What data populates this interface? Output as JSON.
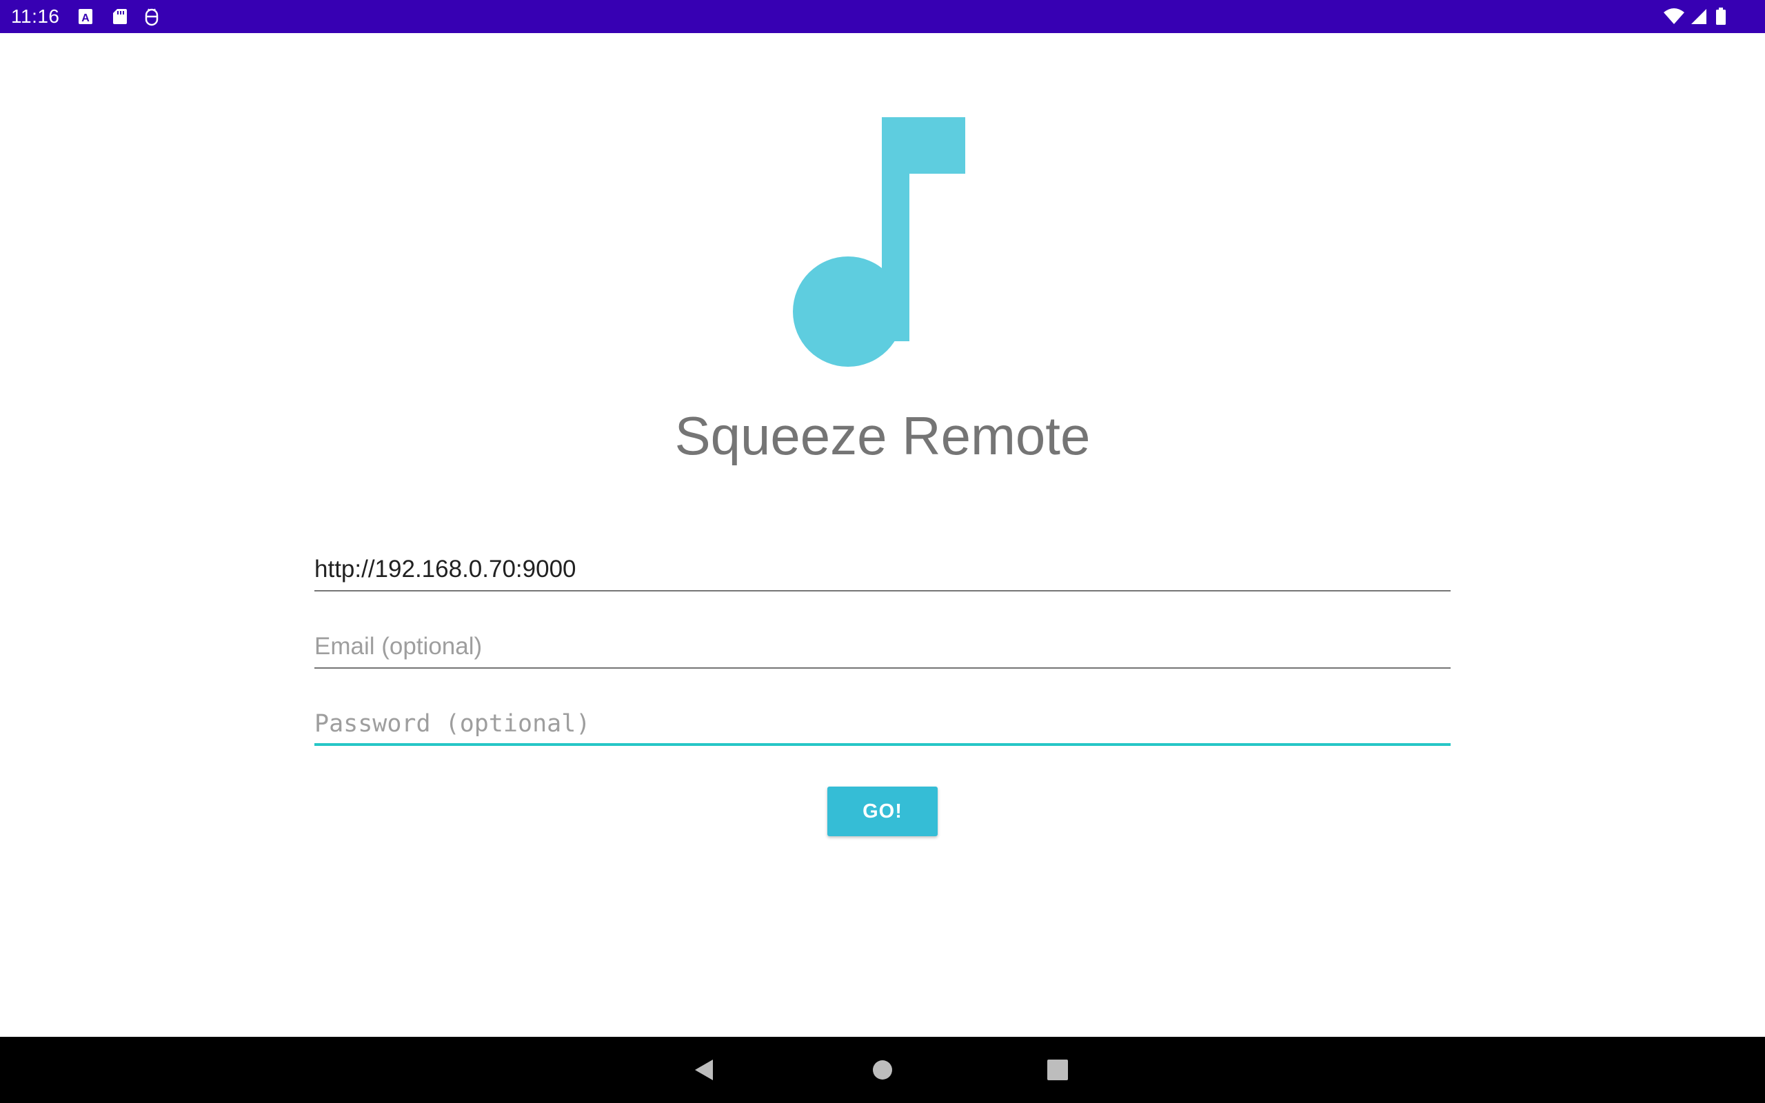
{
  "status_bar": {
    "time": "11:16",
    "left_icons": [
      "text-a-icon",
      "sd-card-icon",
      "android-debug-icon"
    ],
    "right_icons": [
      "wifi-icon",
      "cellular-signal-icon",
      "battery-icon"
    ],
    "background_color": "#3700b3"
  },
  "logo": {
    "icon": "music-note-icon",
    "color": "#5ecddf"
  },
  "app": {
    "title": "Squeeze Remote"
  },
  "form": {
    "server_url": {
      "value": "http://192.168.0.70:9000",
      "placeholder": ""
    },
    "email": {
      "value": "",
      "placeholder": "Email (optional)"
    },
    "password": {
      "value": "",
      "placeholder": "Password (optional)",
      "focused": true,
      "accent_color": "#26c6c6"
    },
    "go_button_label": "GO!",
    "go_button_color": "#35bdd6"
  },
  "nav_bar": {
    "buttons": [
      "back-icon",
      "home-icon",
      "recents-icon"
    ]
  }
}
